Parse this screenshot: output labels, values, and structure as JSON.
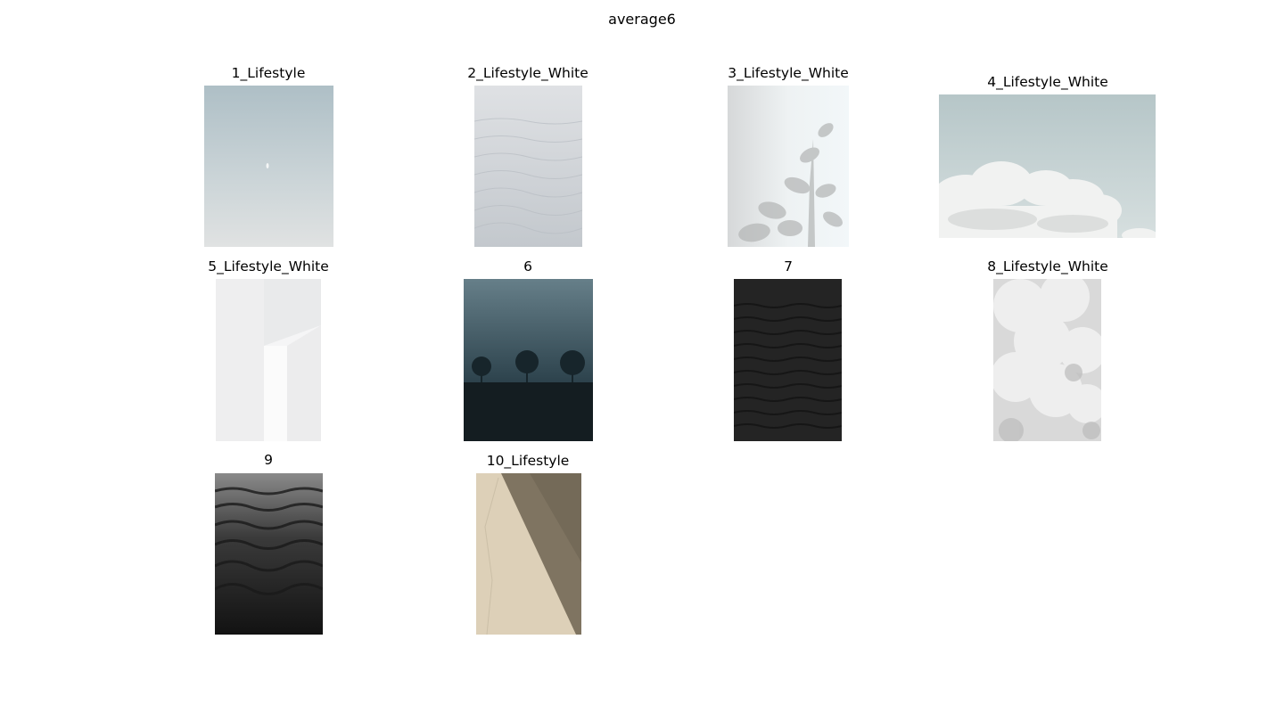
{
  "figure": {
    "title": "average6"
  },
  "panels": [
    {
      "label": "1_Lifestyle",
      "icon": "pale-sky-with-moon-photo"
    },
    {
      "label": "2_Lifestyle_White",
      "icon": "white-sand-dunes-photo"
    },
    {
      "label": "3_Lifestyle_White",
      "icon": "plant-shadow-on-wall-photo"
    },
    {
      "label": "4_Lifestyle_White",
      "icon": "clouds-in-sky-photo"
    },
    {
      "label": "5_Lifestyle_White",
      "icon": "white-architecture-photo"
    },
    {
      "label": "6",
      "icon": "three-trees-in-fog-photo"
    },
    {
      "label": "7",
      "icon": "dark-sand-ripples-photo"
    },
    {
      "label": "8_Lifestyle_White",
      "icon": "white-smoke-photo"
    },
    {
      "label": "9",
      "icon": "dark-sand-waves-photo"
    },
    {
      "label": "10_Lifestyle",
      "icon": "beige-wall-diagonal-shadow-photo"
    }
  ]
}
